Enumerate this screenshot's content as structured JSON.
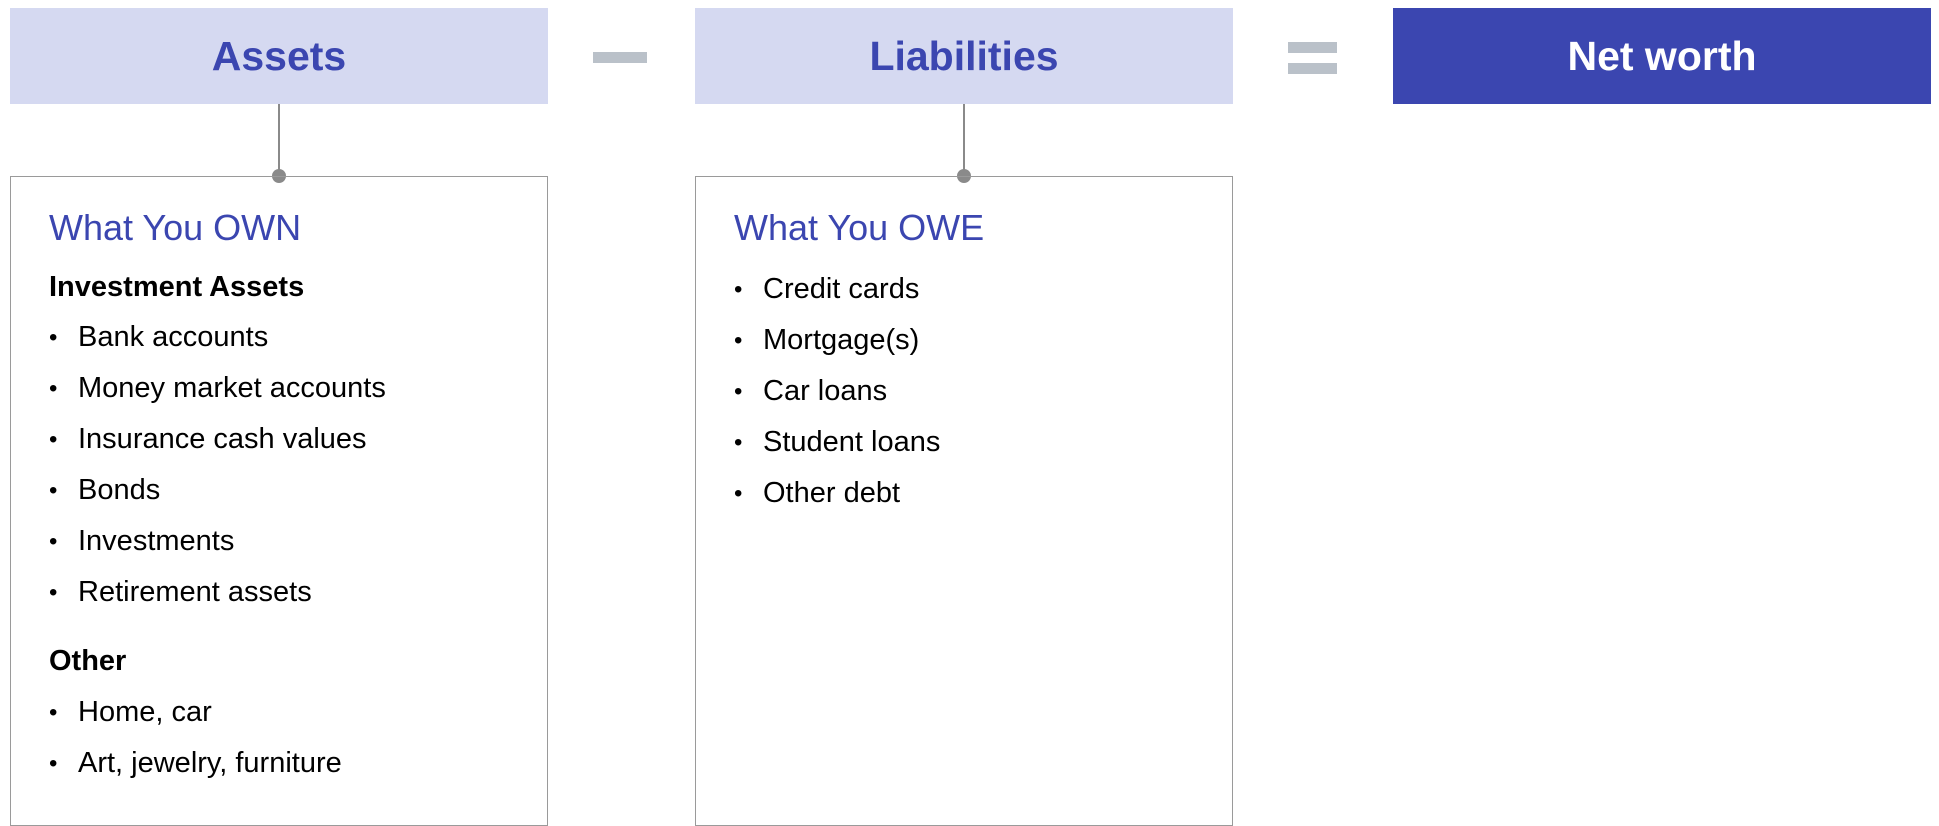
{
  "headers": {
    "assets": "Assets",
    "liabilities": "Liabilities",
    "net_worth": "Net worth"
  },
  "operators": {
    "minus": "minus-sign",
    "equals": "equals-sign"
  },
  "assets_panel": {
    "title": "What You OWN",
    "sections": [
      {
        "title": "Investment Assets",
        "items": [
          "Bank accounts",
          "Money market accounts",
          "Insurance cash values",
          "Bonds",
          "Investments",
          "Retirement assets"
        ]
      },
      {
        "title": "Other",
        "items": [
          "Home, car",
          "Art, jewelry, furniture"
        ]
      }
    ]
  },
  "liabilities_panel": {
    "title": "What You OWE",
    "items": [
      "Credit cards",
      "Mortgage(s)",
      "Car loans",
      "Student loans",
      "Other debt"
    ]
  },
  "colors": {
    "accent": "#3b46b0",
    "header_light_bg": "#d5d9f1",
    "operator": "#bac1c9",
    "connector": "#8a8a8a"
  }
}
